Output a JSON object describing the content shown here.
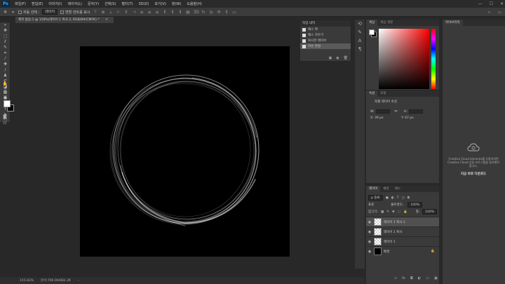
{
  "app": {
    "logo": "Ps",
    "menus": [
      "파일(F)",
      "편집(E)",
      "이미지(I)",
      "레이어(L)",
      "문자(Y)",
      "선택(S)",
      "필터(T)",
      "3D(D)",
      "보기(V)",
      "창(W)",
      "도움말(H)"
    ],
    "window_controls": [
      "—",
      "☐",
      "✕"
    ]
  },
  "options_bar": {
    "auto_select_label": "자동 선택 :",
    "auto_select_value": "레이어",
    "transform_controls_label": "변형 컨트롤 표시"
  },
  "document": {
    "tab_title": "제목 없음-1 @ 156%(레이어 1 복사 2, RGB/8#/CMYK) *",
    "close": "×"
  },
  "status_bar": {
    "zoom": "155.83%",
    "doc_size": "문서:769.0K/882.2K"
  },
  "history_panel": {
    "title": "작업 내역",
    "items": [
      {
        "label": "패스 획",
        "selected": false
      },
      {
        "label": "패스 지우기",
        "selected": false
      },
      {
        "label": "복사한 레이어",
        "selected": false
      },
      {
        "label": "자유 변형",
        "selected": true
      }
    ]
  },
  "color_panel": {
    "tabs": [
      {
        "label": "색상",
        "active": true
      },
      {
        "label": "색상 견본",
        "active": false
      }
    ],
    "foreground": "#ffffff",
    "background": "#000000"
  },
  "properties_panel": {
    "tabs": [
      {
        "label": "속성",
        "active": true
      },
      {
        "label": "조정",
        "active": false
      }
    ],
    "title": "픽셀 레이어 속성",
    "w_label": "W:",
    "h_label": "H:",
    "x_label": "X: 39 px",
    "y_label": "Y: 67 px"
  },
  "layers_panel": {
    "tabs": [
      {
        "label": "레이어",
        "active": true
      },
      {
        "label": "채널",
        "active": false
      },
      {
        "label": "패스",
        "active": false
      }
    ],
    "kind_filter": "ρ 종류",
    "blend_mode": "표준",
    "opacity_label": "불투명도:",
    "opacity_value": "100%",
    "lock_label": "잠그기:",
    "fill_label": "칠:",
    "fill_value": "100%",
    "layers": [
      {
        "name": "레이어 1 복사 2",
        "selected": true,
        "thumb": "transparent"
      },
      {
        "name": "레이어 1 복사",
        "selected": false,
        "thumb": "transparent"
      },
      {
        "name": "레이어 1",
        "selected": false,
        "thumb": "transparent"
      },
      {
        "name": "배경",
        "selected": false,
        "thumb": "black",
        "locked": true
      }
    ]
  },
  "libraries_panel": {
    "title": "라이브러리",
    "message": "Creative Cloud Libraries를 사용하려면 Creative Cloud 응용 프로그램을 설치해야 합니다.",
    "link": "지금 바로 다운로드"
  }
}
